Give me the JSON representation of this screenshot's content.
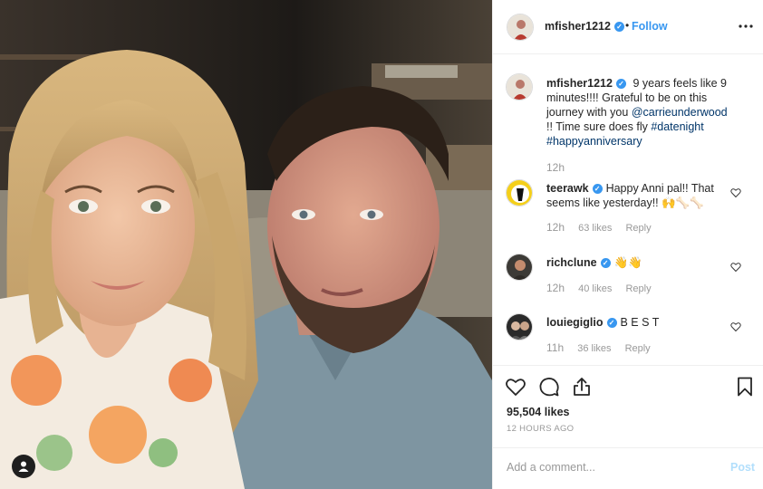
{
  "post": {
    "username": "mfisher1212",
    "follow_label": "Follow",
    "separator": "•",
    "caption": {
      "text_1": "9 years feels like 9 minutes!!!! Grateful to be on this journey with you ",
      "mention": "@carrieunderwood",
      "text_2": " !! Time sure does fly ",
      "hashtag_1": "#datenight",
      "hashtag_2": "#happyanniversary",
      "time": "12h"
    },
    "likes": "95,504 likes",
    "timestamp": "12 HOURS AGO"
  },
  "comments": [
    {
      "username": "teerawk",
      "text": "Happy Anni pal!! That seems like yesterday!! ",
      "emoji": "🙌🦴🦴",
      "time": "12h",
      "likes": "63 likes",
      "reply": "Reply"
    },
    {
      "username": "richclune",
      "text": "",
      "emoji": "👋👋",
      "time": "12h",
      "likes": "40 likes",
      "reply": "Reply"
    },
    {
      "username": "louiegiglio",
      "text": "B E S T",
      "emoji": "",
      "time": "11h",
      "likes": "36 likes",
      "reply": "Reply"
    }
  ],
  "composer": {
    "placeholder": "Add a comment...",
    "post_label": "Post"
  },
  "colors": {
    "accent": "#3897f0",
    "link": "#003569",
    "muted": "#999999",
    "border": "#efefef"
  },
  "icons": [
    "user-tag-icon",
    "verified-badge-icon",
    "more-options-icon",
    "heart-icon",
    "comment-icon",
    "share-icon",
    "bookmark-icon"
  ]
}
